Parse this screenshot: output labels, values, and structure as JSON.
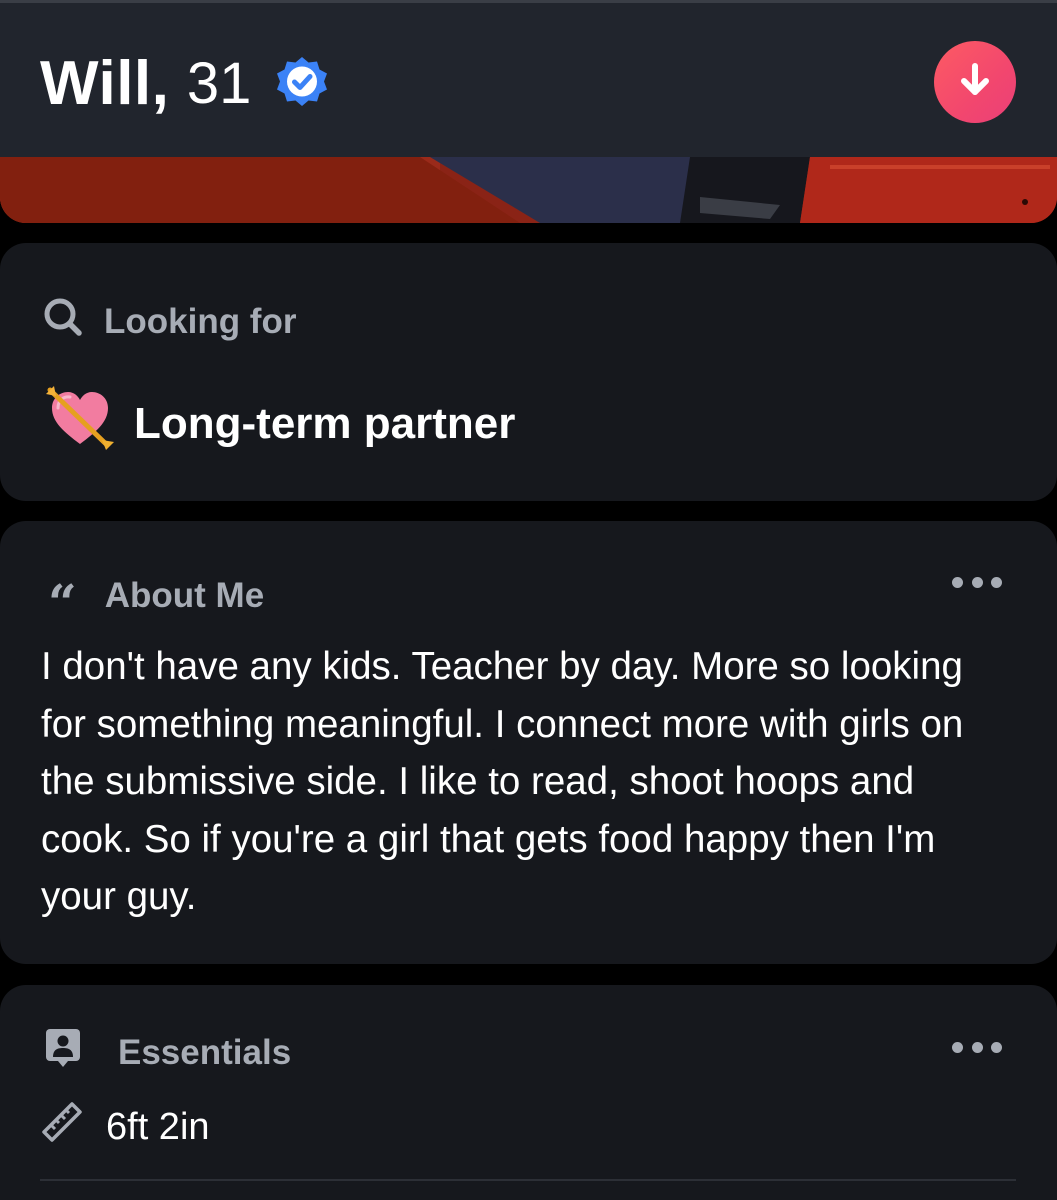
{
  "profile": {
    "name": "Will",
    "separator": ",",
    "age": "31",
    "verified_icon": "verified-badge-icon",
    "collapse_icon": "arrow-down-icon",
    "accent": "#f6506b",
    "verified_color": "#3b82f6"
  },
  "looking_for": {
    "icon": "search-icon",
    "label": "Looking for",
    "emoji": "💘",
    "value": "Long-term partner"
  },
  "about": {
    "icon": "quote-icon",
    "quote_glyph": "“",
    "label": "About Me",
    "more_icon": "more-dots-icon",
    "text": "I don't have any kids. Teacher by day. More so looking for something meaningful. I connect more with girls on the submissive side. I like to read, shoot hoops and cook. So if you're a girl that gets food happy then I'm your guy."
  },
  "essentials": {
    "icon": "id-card-icon",
    "label": "Essentials",
    "more_icon": "more-dots-icon",
    "items": [
      {
        "icon": "ruler-icon",
        "value": "6ft 2in"
      }
    ]
  }
}
